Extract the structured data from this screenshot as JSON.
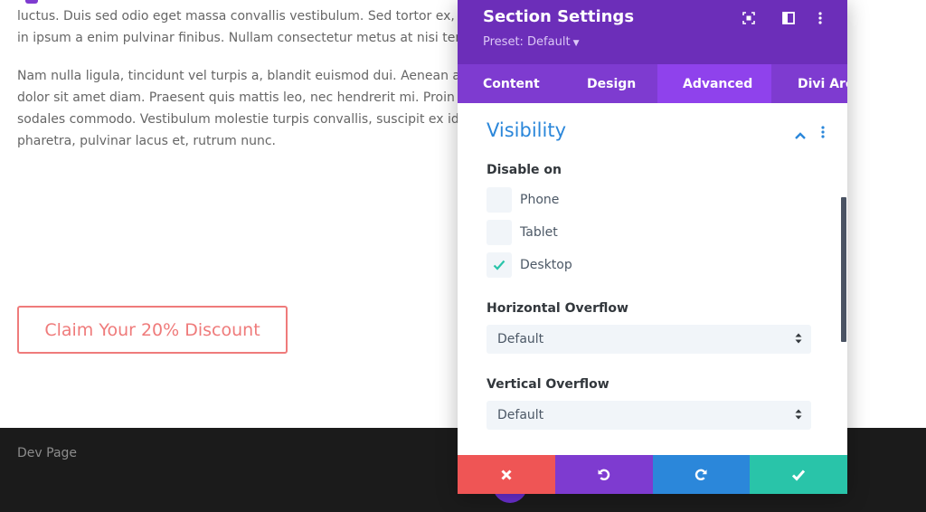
{
  "page": {
    "paragraph1": [
      "luctus. Duis sed odio eget massa convallis vestibulum. Sed tortor ex, b                                                                                          ium ut auctu",
      "in ipsum a enim pulvinar finibus. Nullam consectetur metus at nisi ter                                                                                          lisis tempor"
    ],
    "paragraph2": [
      "Nam nulla ligula, tincidunt vel turpis a, blandit euismod dui. Aenean a                                                                                          risus, nec lac",
      "dolor sit amet diam. Praesent quis mattis leo, nec hendrerit mi. Proin                                                                                          amus sodale",
      "sodales commodo. Vestibulum molestie turpis convallis, suscipit ex id                                                                                          r. Nulla non l",
      "pharetra, pulvinar lacus et, rutrum nunc."
    ],
    "cta_label": "Claim Your 20% Discount",
    "footer_text": "Dev Page"
  },
  "modal": {
    "title": "Section Settings",
    "preset": "Preset: Default",
    "header_icons": [
      "fullscreen-icon",
      "columns-icon",
      "kebab-icon"
    ],
    "tabs": [
      {
        "label": "Content",
        "active": false
      },
      {
        "label": "Design",
        "active": false
      },
      {
        "label": "Advanced",
        "active": true
      },
      {
        "label": "Divi Are",
        "active": false
      }
    ],
    "section": {
      "title": "Visibility",
      "disable_on_label": "Disable on",
      "devices": [
        {
          "label": "Phone",
          "checked": false
        },
        {
          "label": "Tablet",
          "checked": false
        },
        {
          "label": "Desktop",
          "checked": true
        }
      ],
      "horizontal_overflow": {
        "label": "Horizontal Overflow",
        "value": "Default"
      },
      "vertical_overflow": {
        "label": "Vertical Overflow",
        "value": "Default"
      }
    },
    "footer_buttons": [
      "close-icon",
      "undo-icon",
      "redo-icon",
      "check-icon"
    ]
  },
  "colors": {
    "header": "#6c2eb9",
    "tabs": "#7e3bd0",
    "tab_active": "#8f42ec",
    "section_title": "#2b87da",
    "cta": "#ef7b7b",
    "cancel": "#ef5555",
    "undo": "#7e3bd0",
    "redo": "#2b87da",
    "save": "#29c4a9",
    "check": "#29c4a9"
  }
}
